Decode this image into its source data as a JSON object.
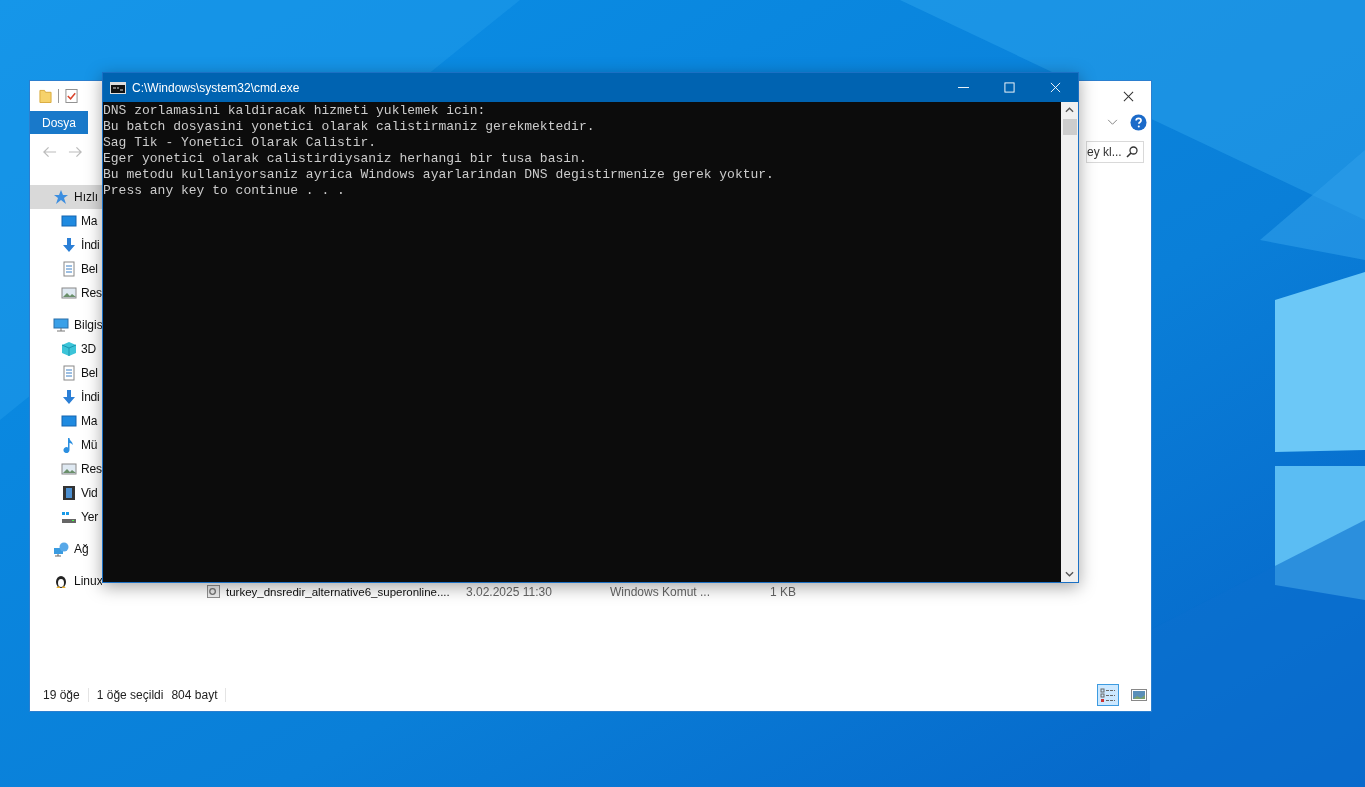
{
  "explorer": {
    "ribbon_tab": "Dosya",
    "search": {
      "placeholder": "ey kl..."
    },
    "sidebar": [
      {
        "label": "Hızlı",
        "kind": "star",
        "selected": true,
        "children": [
          {
            "label": "Ma",
            "kind": "desktop",
            "selected": false
          },
          {
            "label": "İndi",
            "kind": "download",
            "selected": false
          },
          {
            "label": "Bel",
            "kind": "document",
            "selected": false
          },
          {
            "label": "Res",
            "kind": "pictures",
            "selected": false
          }
        ]
      },
      {
        "label": "Bilgis",
        "kind": "computer",
        "selected": false,
        "children": [
          {
            "label": "3D",
            "kind": "cube",
            "selected": false
          },
          {
            "label": "Bel",
            "kind": "document",
            "selected": false
          },
          {
            "label": "İndi",
            "kind": "download",
            "selected": false
          },
          {
            "label": "Ma",
            "kind": "desktop",
            "selected": false
          },
          {
            "label": "Mü",
            "kind": "music",
            "selected": false
          },
          {
            "label": "Res",
            "kind": "pictures",
            "selected": false
          },
          {
            "label": "Vid",
            "kind": "video",
            "selected": false
          },
          {
            "label": "Yer",
            "kind": "drive",
            "selected": false
          }
        ]
      },
      {
        "label": "Ağ",
        "kind": "network",
        "selected": false
      },
      {
        "label": "Linux",
        "kind": "penguin",
        "selected": false
      }
    ],
    "files": [
      {
        "name": "turkey_dnsredir_alternative6_superonline....",
        "date": "3.02.2025 11:30",
        "type": "Windows Komut ...",
        "size": "1 KB",
        "selected": false
      }
    ],
    "status_bar": {
      "count": "19 öğe",
      "selection": "1 öğe seçildi",
      "size": "804 bayt"
    },
    "views": [
      {
        "kind": "details",
        "selected": true
      },
      {
        "kind": "large_icons",
        "selected": false
      }
    ]
  },
  "cmd_window": {
    "title": "C:\\Windows\\system32\\cmd.exe",
    "lines": [
      "DNS zorlamasini kaldiracak hizmeti yuklemek icin:",
      "Bu batch dosyasini yonetici olarak calistirmaniz gerekmektedir.",
      "Sag Tik - Yonetici Olarak Calistir.",
      "Eger yonetici olarak calistirdiysaniz herhangi bir tusa basin.",
      "Bu metodu kullaniyorsaniz ayrica Windows ayarlarindan DNS degistirmenize gerek yoktur.",
      "Press any key to continue . . ."
    ]
  }
}
